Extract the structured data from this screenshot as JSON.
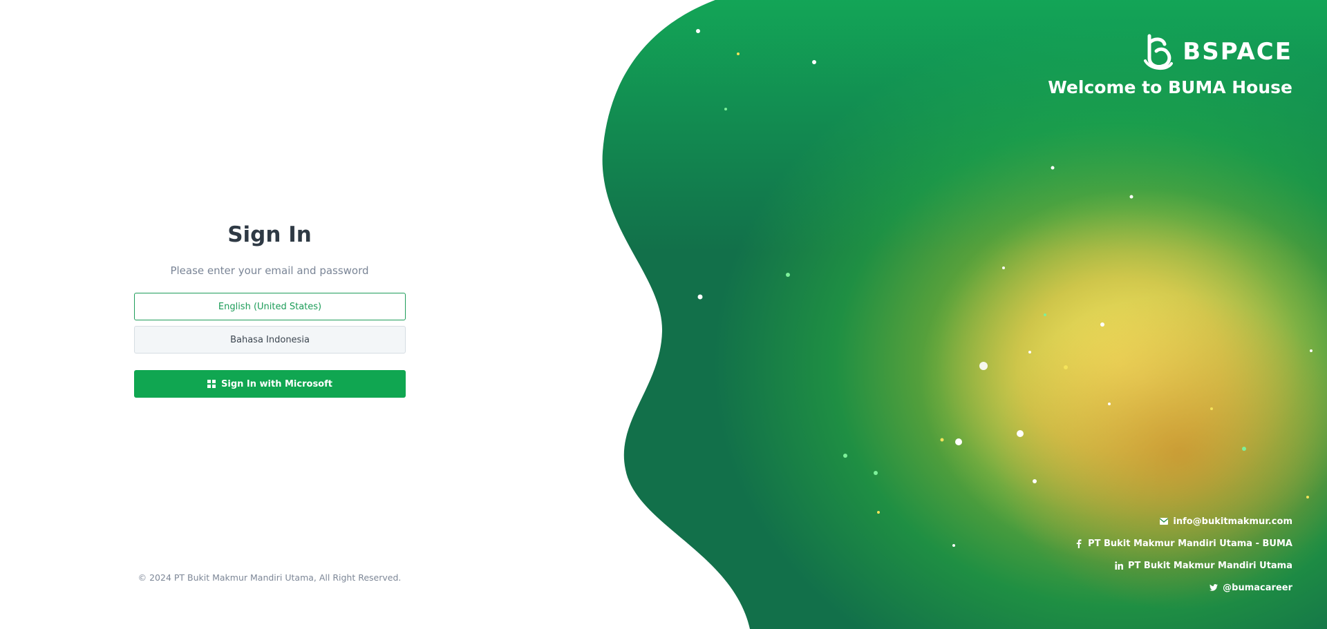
{
  "signin": {
    "title": "Sign In",
    "subtitle": "Please enter your email and password",
    "languages": [
      {
        "label": "English (United States)",
        "selected": true
      },
      {
        "label": "Bahasa Indonesia",
        "selected": false
      }
    ],
    "microsoft_button": "Sign In with Microsoft"
  },
  "footer": {
    "copyright": "© 2024 PT Bukit Makmur Mandiri Utama, All Right Reserved."
  },
  "brand": {
    "logo_text": "BSPACE",
    "welcome": "Welcome to BUMA House"
  },
  "contacts": [
    {
      "icon": "mail-icon",
      "text": "info@bukitmakmur.com"
    },
    {
      "icon": "facebook-icon",
      "text": "PT Bukit Makmur Mandiri Utama - BUMA"
    },
    {
      "icon": "linkedin-icon",
      "text": "PT Bukit Makmur Mandiri Utama"
    },
    {
      "icon": "twitter-icon",
      "text": "@bumacareer"
    }
  ],
  "colors": {
    "accent": "#10a651",
    "accent_border": "#1c9c58",
    "text_dark": "#2f3a45",
    "text_muted": "#7a8596"
  }
}
